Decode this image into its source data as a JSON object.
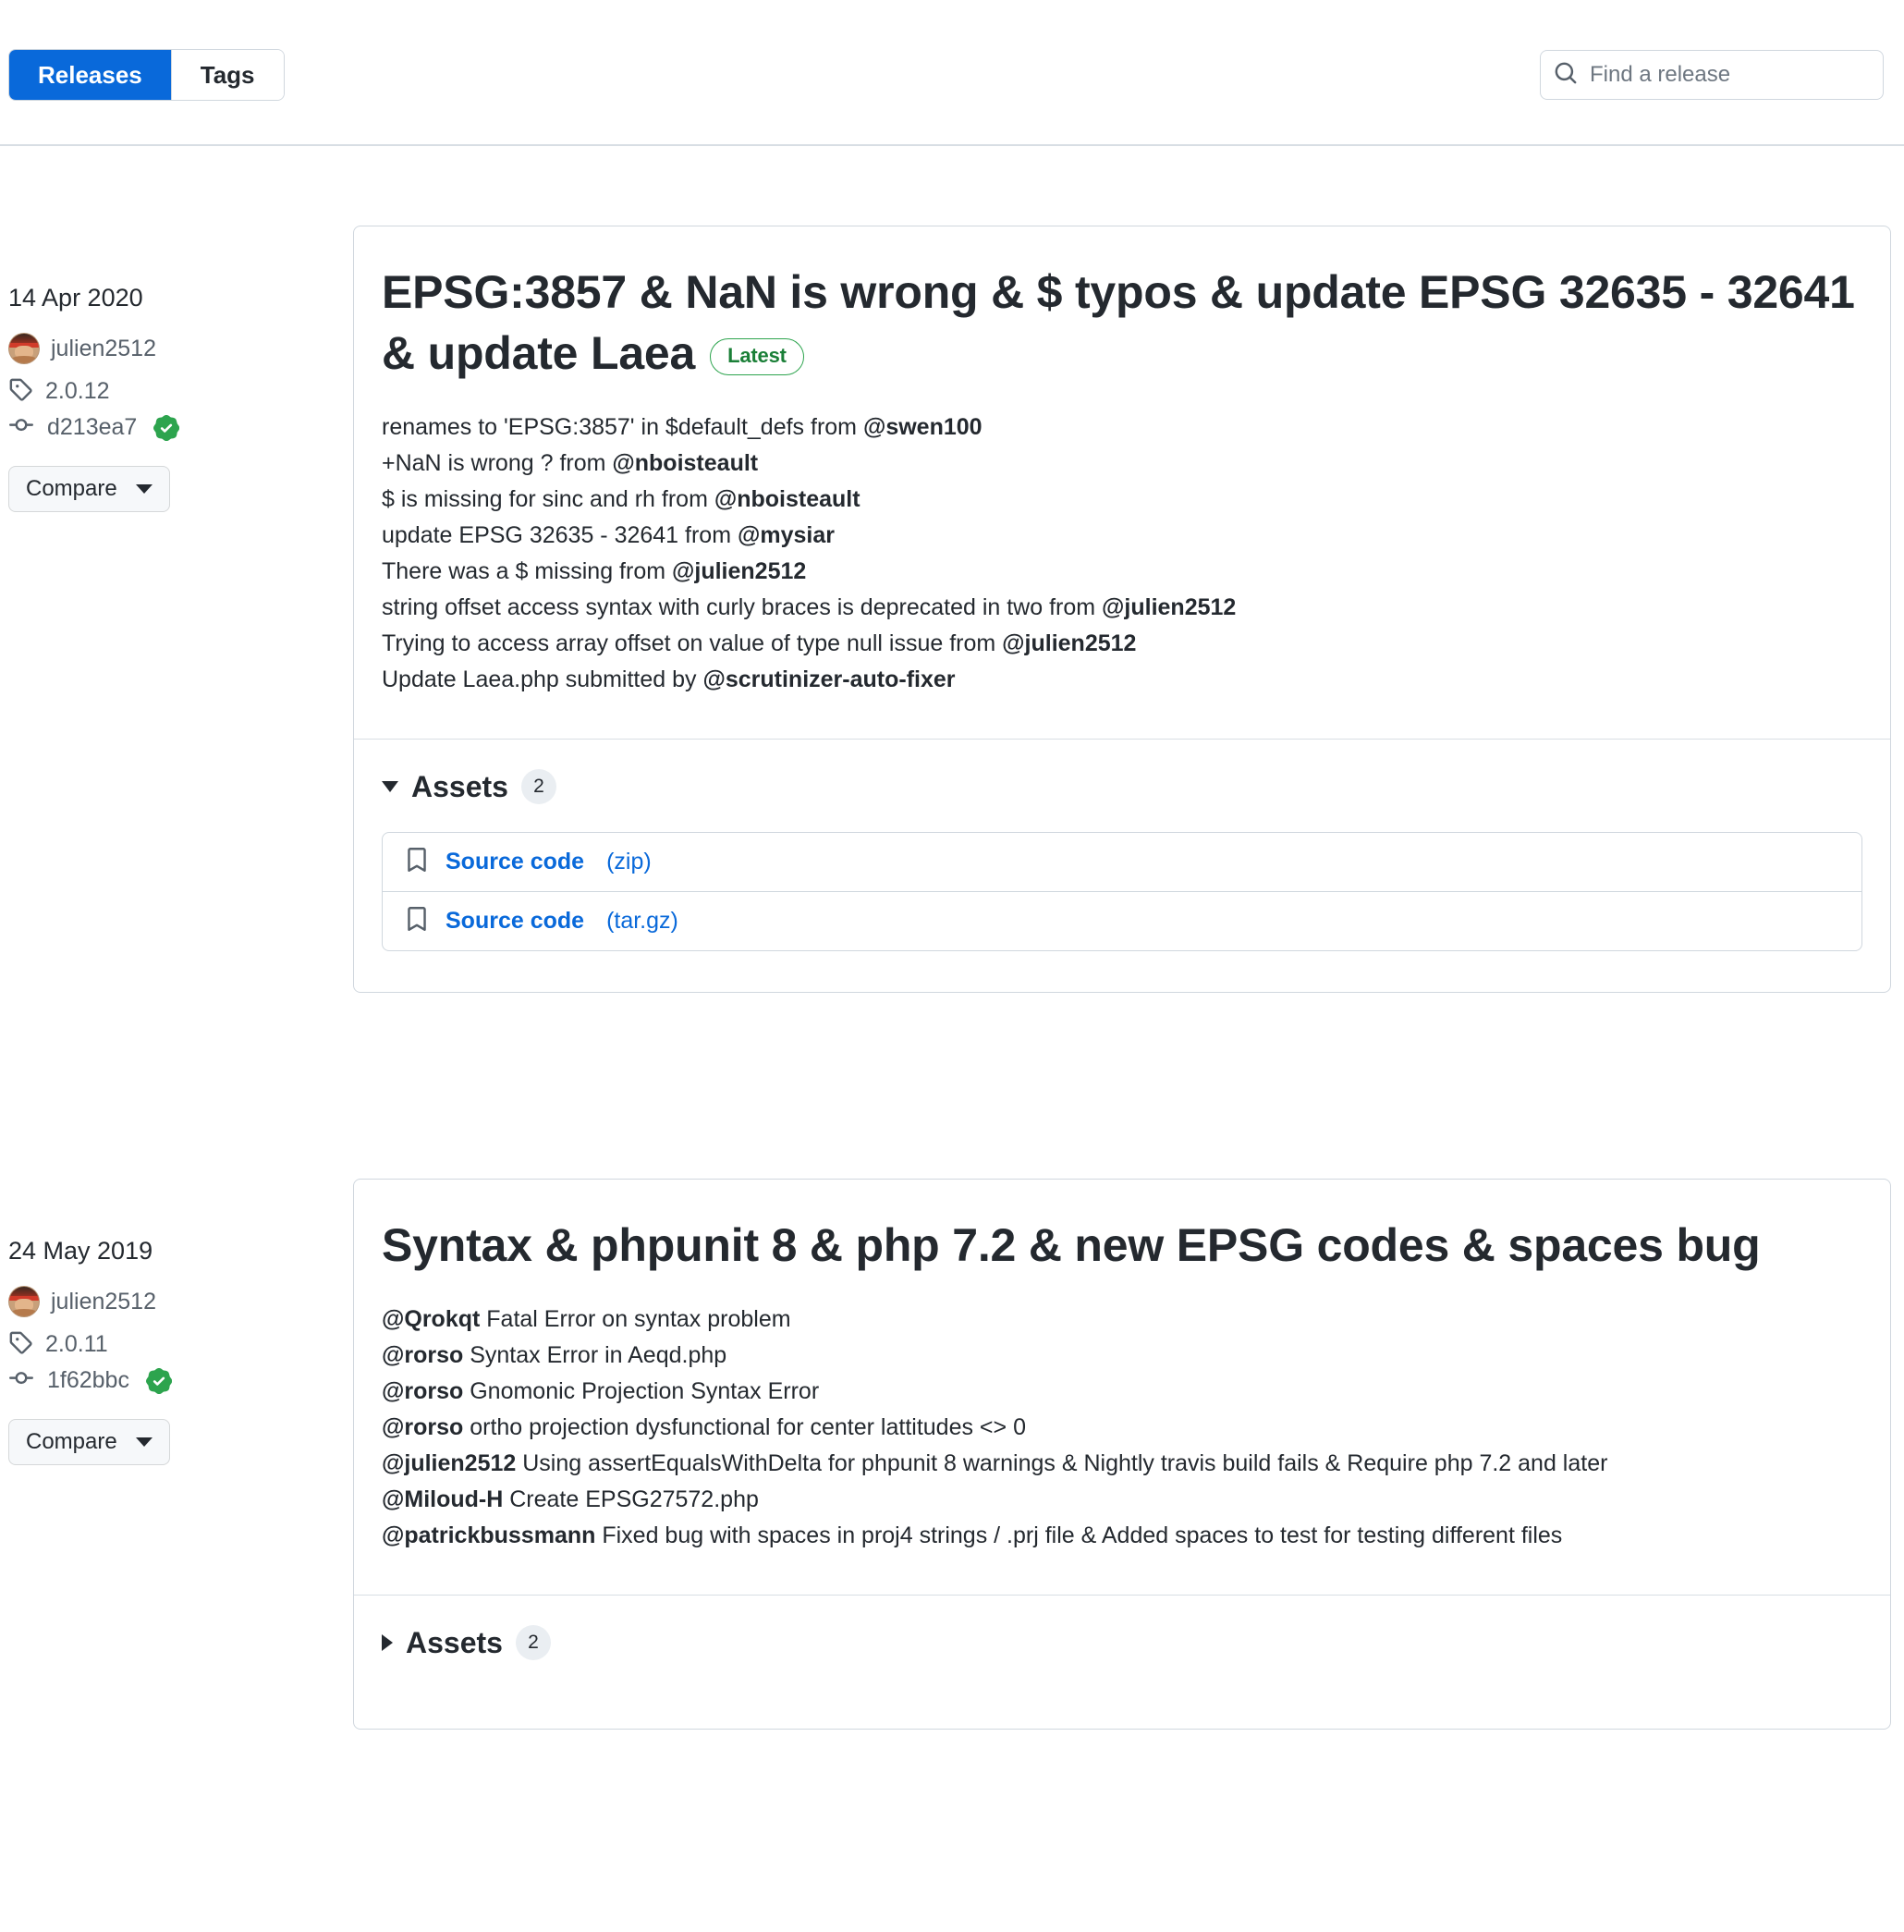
{
  "header": {
    "tabs": [
      {
        "label": "Releases",
        "active": true
      },
      {
        "label": "Tags",
        "active": false
      }
    ],
    "search": {
      "placeholder": "Find a release",
      "value": "",
      "icon": "search-icon"
    }
  },
  "releases": [
    {
      "date": "14 Apr 2020",
      "author": "julien2512",
      "tag": "2.0.12",
      "commit": "d213ea7",
      "verified": true,
      "compare_label": "Compare",
      "title": "EPSG:3857 & NaN is wrong & $ typos & update EPSG 32635 - 32641 & update Laea",
      "badge": "Latest",
      "notes": [
        [
          {
            "t": "renames to 'EPSG:3857' in $default_defs from ",
            "b": false
          },
          {
            "t": "@swen100",
            "b": true
          }
        ],
        [
          {
            "t": "+NaN is wrong ? from ",
            "b": false
          },
          {
            "t": "@nboisteault",
            "b": true
          }
        ],
        [
          {
            "t": "$ is missing for sinc and rh from ",
            "b": false
          },
          {
            "t": "@nboisteault",
            "b": true
          }
        ],
        [
          {
            "t": "update EPSG 32635 - 32641 from ",
            "b": false
          },
          {
            "t": "@mysiar",
            "b": true
          }
        ],
        [
          {
            "t": "There was a $ missing from ",
            "b": false
          },
          {
            "t": "@julien2512",
            "b": true
          }
        ],
        [
          {
            "t": "string offset access syntax with curly braces is deprecated in two from ",
            "b": false
          },
          {
            "t": "@julien2512",
            "b": true
          }
        ],
        [
          {
            "t": "Trying to access array offset on value of type null issue from ",
            "b": false
          },
          {
            "t": "@julien2512",
            "b": true
          }
        ],
        [
          {
            "t": "Update Laea.php submitted by ",
            "b": false
          },
          {
            "t": "@scrutinizer-auto-fixer",
            "b": true
          }
        ]
      ],
      "assets": {
        "label": "Assets",
        "count": "2",
        "expanded": true,
        "items": [
          {
            "name": "Source code",
            "ext": "(zip)"
          },
          {
            "name": "Source code",
            "ext": "(tar.gz)"
          }
        ]
      }
    },
    {
      "date": "24 May 2019",
      "author": "julien2512",
      "tag": "2.0.11",
      "commit": "1f62bbc",
      "verified": true,
      "compare_label": "Compare",
      "title": "Syntax & phpunit 8 & php 7.2 & new EPSG codes & spaces bug",
      "badge": "",
      "notes": [
        [
          {
            "t": "@Qrokqt",
            "b": true
          },
          {
            "t": " Fatal Error on syntax problem",
            "b": false
          }
        ],
        [
          {
            "t": "@rorso",
            "b": true
          },
          {
            "t": " Syntax Error in Aeqd.php",
            "b": false
          }
        ],
        [
          {
            "t": "@rorso",
            "b": true
          },
          {
            "t": " Gnomonic Projection Syntax Error",
            "b": false
          }
        ],
        [
          {
            "t": "@rorso",
            "b": true
          },
          {
            "t": " ortho projection dysfunctional for center lattitudes <> 0",
            "b": false
          }
        ],
        [
          {
            "t": "@julien2512",
            "b": true
          },
          {
            "t": " Using assertEqualsWithDelta for phpunit 8 warnings & Nightly travis build fails & Require php 7.2 and later",
            "b": false
          }
        ],
        [
          {
            "t": "@Miloud-H",
            "b": true
          },
          {
            "t": " Create EPSG27572.php",
            "b": false
          }
        ],
        [
          {
            "t": "@patrickbussmann",
            "b": true
          },
          {
            "t": " Fixed bug with spaces in proj4 strings / .prj file & Added spaces to test for testing different files",
            "b": false
          }
        ]
      ],
      "assets": {
        "label": "Assets",
        "count": "2",
        "expanded": false,
        "items": []
      }
    }
  ],
  "colors": {
    "accent": "#0969da",
    "verified_green": "#2da44e",
    "latest_green": "#1a7f37",
    "border": "#d0d7de",
    "muted_text": "#57606a"
  }
}
